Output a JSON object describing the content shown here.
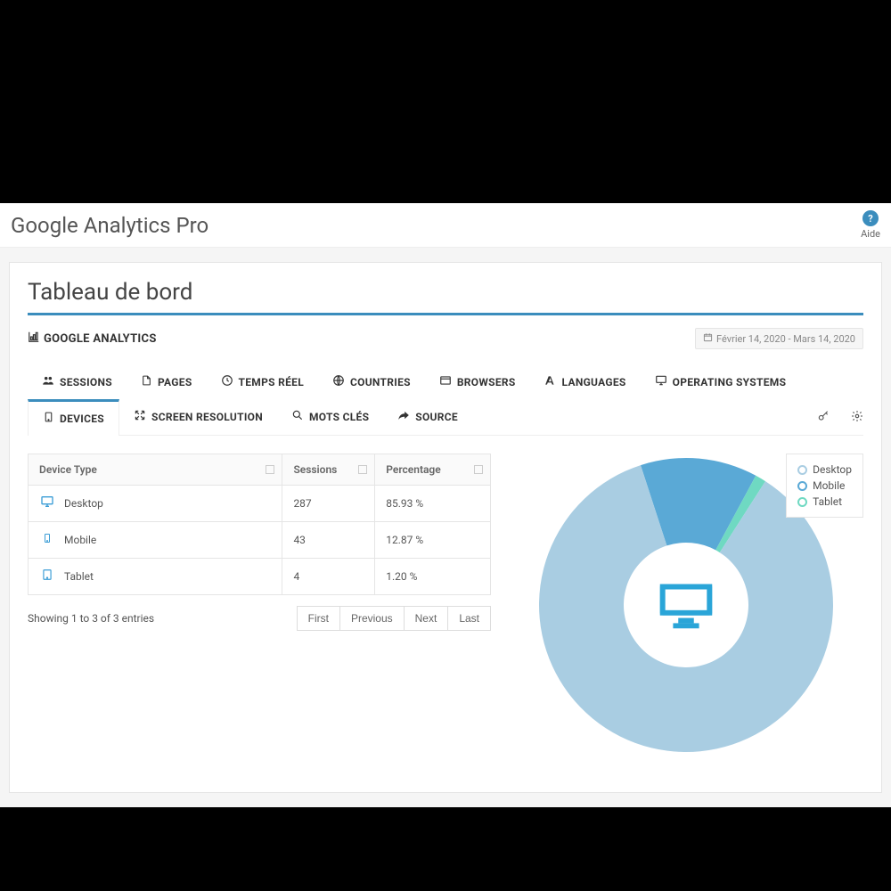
{
  "header": {
    "app_title": "Google Analytics Pro",
    "help_label": "Aide"
  },
  "page": {
    "title": "Tableau de bord",
    "subtitle": "GOOGLE ANALYTICS",
    "daterange": "Février 14, 2020 - Mars 14, 2020"
  },
  "tabs": {
    "items": [
      {
        "label": "SESSIONS",
        "icon": "users"
      },
      {
        "label": "PAGES",
        "icon": "file"
      },
      {
        "label": "TEMPS RÉEL",
        "icon": "clock"
      },
      {
        "label": "COUNTRIES",
        "icon": "globe"
      },
      {
        "label": "BROWSERS",
        "icon": "window"
      },
      {
        "label": "LANGUAGES",
        "icon": "font"
      },
      {
        "label": "OPERATING SYSTEMS",
        "icon": "monitor"
      },
      {
        "label": "DEVICES",
        "icon": "tablet",
        "active": true
      },
      {
        "label": "SCREEN RESOLUTION",
        "icon": "expand"
      },
      {
        "label": "MOTS CLÉS",
        "icon": "search"
      },
      {
        "label": "SOURCE",
        "icon": "share"
      }
    ]
  },
  "table": {
    "columns": [
      "Device Type",
      "Sessions",
      "Percentage"
    ],
    "rows": [
      {
        "name": "Desktop",
        "icon": "desktop",
        "sessions": "287",
        "percentage": "85.93 %"
      },
      {
        "name": "Mobile",
        "icon": "mobile",
        "sessions": "43",
        "percentage": "12.87 %"
      },
      {
        "name": "Tablet",
        "icon": "tablet",
        "sessions": "4",
        "percentage": "1.20 %"
      }
    ],
    "footer_info": "Showing 1 to 3 of 3 entries",
    "pager": {
      "first": "First",
      "previous": "Previous",
      "next": "Next",
      "last": "Last"
    }
  },
  "legend": {
    "items": [
      {
        "label": "Desktop",
        "color": "#a9cde2"
      },
      {
        "label": "Mobile",
        "color": "#5aa9d6"
      },
      {
        "label": "Tablet",
        "color": "#6fd9c2"
      }
    ]
  },
  "chart_data": {
    "type": "pie",
    "title": "Devices",
    "series": [
      {
        "name": "Desktop",
        "value": 85.93,
        "color": "#a9cde2"
      },
      {
        "name": "Mobile",
        "value": 12.87,
        "color": "#5aa9d6"
      },
      {
        "name": "Tablet",
        "value": 1.2,
        "color": "#6fd9c2"
      }
    ],
    "inner_radius": 0.4
  }
}
